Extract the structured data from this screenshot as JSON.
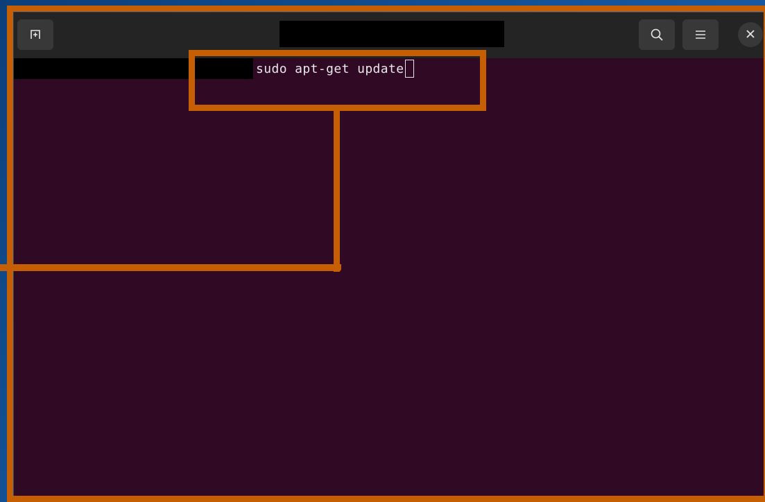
{
  "window": {
    "title": "",
    "buttons": {
      "new_tab_icon": "new-tab-icon",
      "search_icon": "search-icon",
      "menu_icon": "hamburger-menu-icon",
      "close_icon": "close-icon"
    }
  },
  "terminal": {
    "prompt": "",
    "command": "sudo apt-get update",
    "background": "#300a24",
    "foreground": "#e8e8e8"
  },
  "annotation": {
    "color": "#c65f04"
  }
}
